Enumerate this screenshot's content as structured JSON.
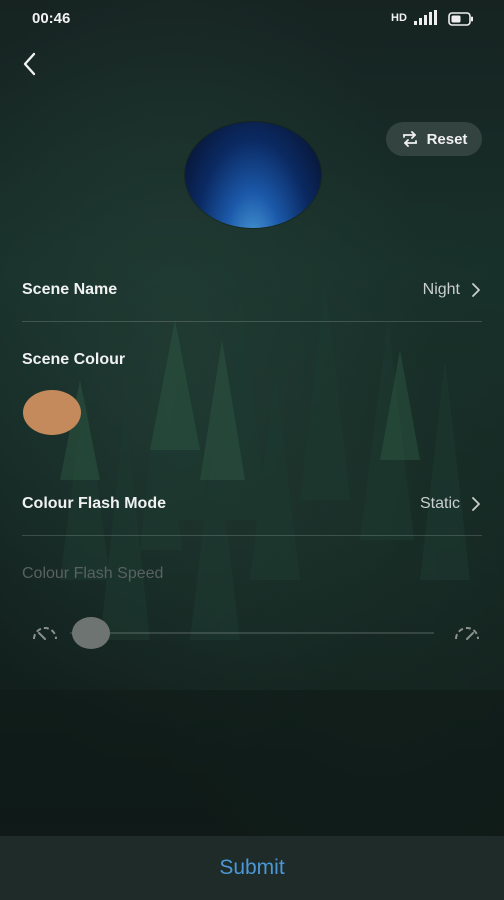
{
  "status_bar": {
    "time": "00:46",
    "network": "HD"
  },
  "header": {
    "reset_label": "Reset"
  },
  "rows": {
    "scene_name": {
      "label": "Scene Name",
      "value": "Night"
    },
    "scene_colour": {
      "label": "Scene Colour",
      "swatch_color": "#c48a5b"
    },
    "flash_mode": {
      "label": "Colour Flash Mode",
      "value": "Static"
    },
    "flash_speed": {
      "label": "Colour Flash Speed",
      "level": 0
    }
  },
  "footer": {
    "submit_label": "Submit"
  },
  "colors": {
    "accent": "#4c97d6",
    "background": "#162321"
  },
  "icons": [
    "back-arrow-icon",
    "refresh-icon",
    "signal-icon",
    "battery-icon",
    "speed-slow-icon",
    "speed-fast-icon",
    "chevron-right-icon"
  ]
}
